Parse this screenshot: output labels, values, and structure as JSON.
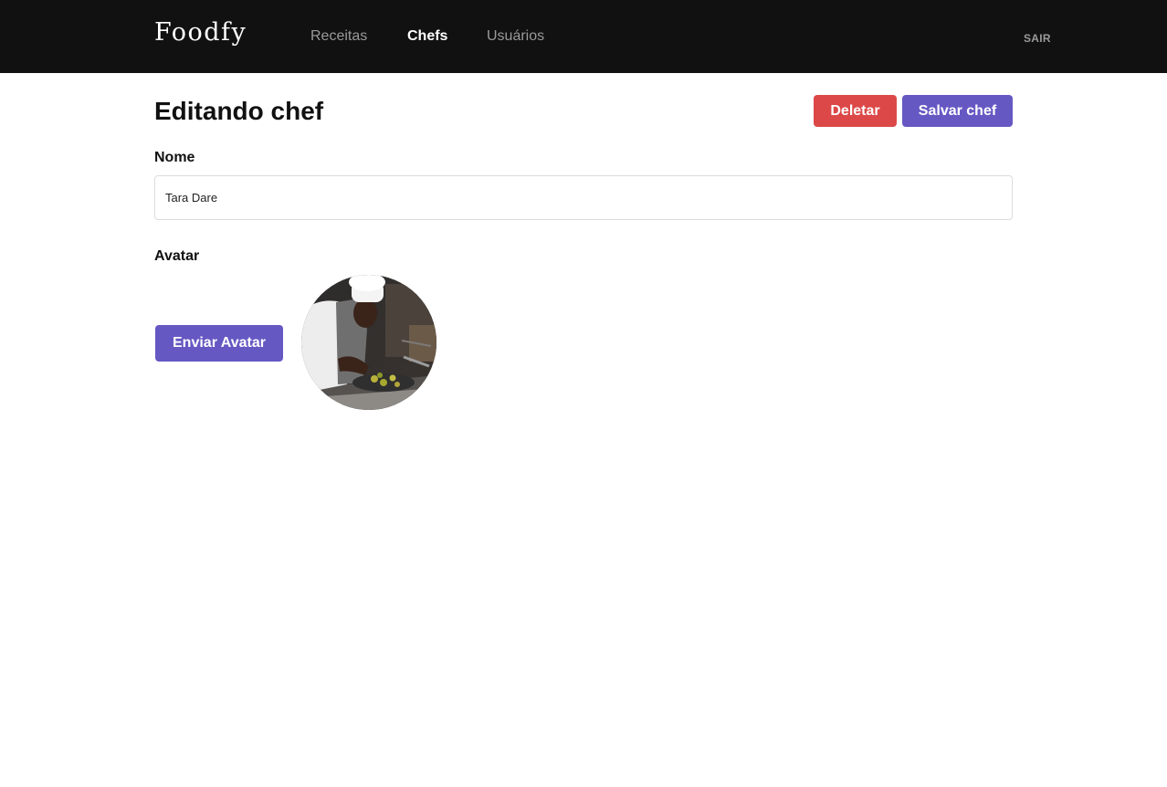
{
  "header": {
    "logo": "Foodfy",
    "nav": [
      {
        "label": "Receitas",
        "active": false
      },
      {
        "label": "Chefs",
        "active": true
      },
      {
        "label": "Usuários",
        "active": false
      }
    ],
    "logout_label": "SAIR"
  },
  "page": {
    "title": "Editando chef",
    "delete_label": "Deletar",
    "save_label": "Salvar chef"
  },
  "form": {
    "name_label": "Nome",
    "name_value": "Tara Dare",
    "avatar_label": "Avatar",
    "upload_label": "Enviar Avatar"
  },
  "colors": {
    "topbar": "#111111",
    "accent": "#6558c3",
    "danger": "#dc4848"
  }
}
